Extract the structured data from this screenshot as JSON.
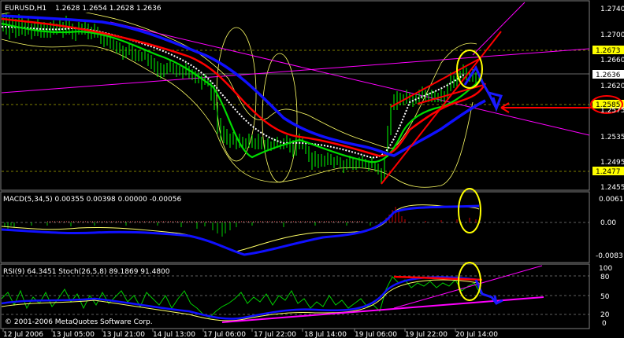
{
  "main": {
    "symbol_tf": "EURUSD,H1",
    "ohlc": "1.2628 1.2654 1.2628 1.2636",
    "price_labels": [
      "1.2740",
      "1.2700",
      "1.2660",
      "1.2620",
      "1.2575",
      "1.2535",
      "1.2495",
      "1.2455"
    ],
    "highlight_labels": {
      "yellow_top": "1.2673",
      "yellow_bottom": "1.2477",
      "white_current": "1.2636",
      "circled": "1.2585"
    }
  },
  "macd": {
    "title": "MACD(5,34,5) 0.00355 0.00398 0.00000 -0.00056",
    "labels": [
      "0.00617",
      "0.00",
      "-0.0083"
    ]
  },
  "osc": {
    "title": "RSI(9) 64.3451   Stoch(26,5,8) 89.1869 91.4800",
    "labels": [
      "100",
      "80",
      "50",
      "20",
      "0"
    ]
  },
  "copyright": "© 2001-2006 MetaQuotes Software Corp.",
  "time_labels": [
    "12 Jul 2006",
    "13 Jul 05:00",
    "13 Jul 21:00",
    "14 Jul 13:00",
    "17 Jul 06:00",
    "17 Jul 22:00",
    "18 Jul 14:00",
    "19 Jul 06:00",
    "19 Jul 22:00",
    "20 Jul 14:00"
  ],
  "colors": {
    "bg": "#000000",
    "candle": "#00ff00",
    "ma_fast": "#00dd00",
    "ma_mid": "#ff0000",
    "ma_slow": "#1010ff",
    "bb": "#ffff66",
    "trend": "#ff00ff",
    "annot_red": "#ff0000",
    "annot_yellow": "#ffff00",
    "annot_blue": "#1a1aff"
  }
}
